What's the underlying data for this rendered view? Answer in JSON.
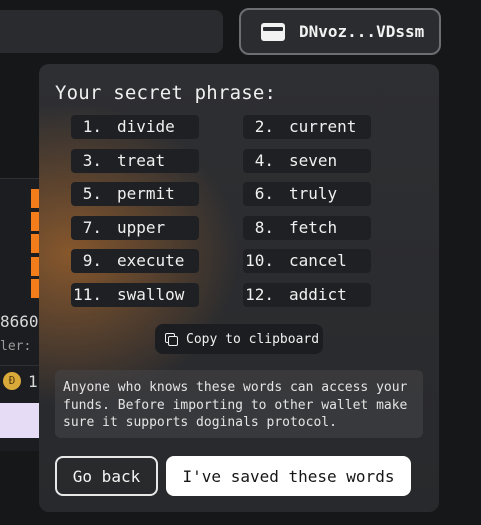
{
  "header": {
    "wallet_address": "DNvoz...VDssm",
    "wallet_icon": "wallet-icon"
  },
  "background": {
    "number": "8660",
    "label": "ler:",
    "doge_value": "1",
    "doge_icon": "doge-icon"
  },
  "modal": {
    "title": "Your secret phrase:",
    "words": [
      {
        "num": "1.",
        "word": "divide"
      },
      {
        "num": "2.",
        "word": "current"
      },
      {
        "num": "3.",
        "word": "treat"
      },
      {
        "num": "4.",
        "word": "seven"
      },
      {
        "num": "5.",
        "word": "permit"
      },
      {
        "num": "6.",
        "word": "truly"
      },
      {
        "num": "7.",
        "word": "upper"
      },
      {
        "num": "8.",
        "word": "fetch"
      },
      {
        "num": "9.",
        "word": "execute"
      },
      {
        "num": "10.",
        "word": "cancel"
      },
      {
        "num": "11.",
        "word": "swallow"
      },
      {
        "num": "12.",
        "word": "addict"
      }
    ],
    "copy_label": "Copy to clipboard",
    "copy_icon": "copy-icon",
    "warning": "Anyone who knows these words can access your funds. Before importing to other wallet make sure it supports doginals protocol.",
    "back_label": "Go back",
    "saved_label": "I've saved these words"
  },
  "colors": {
    "accent_orange": "#f27d1a",
    "modal_bg": "#2b2c2f",
    "primary_button": "#ffffff"
  }
}
